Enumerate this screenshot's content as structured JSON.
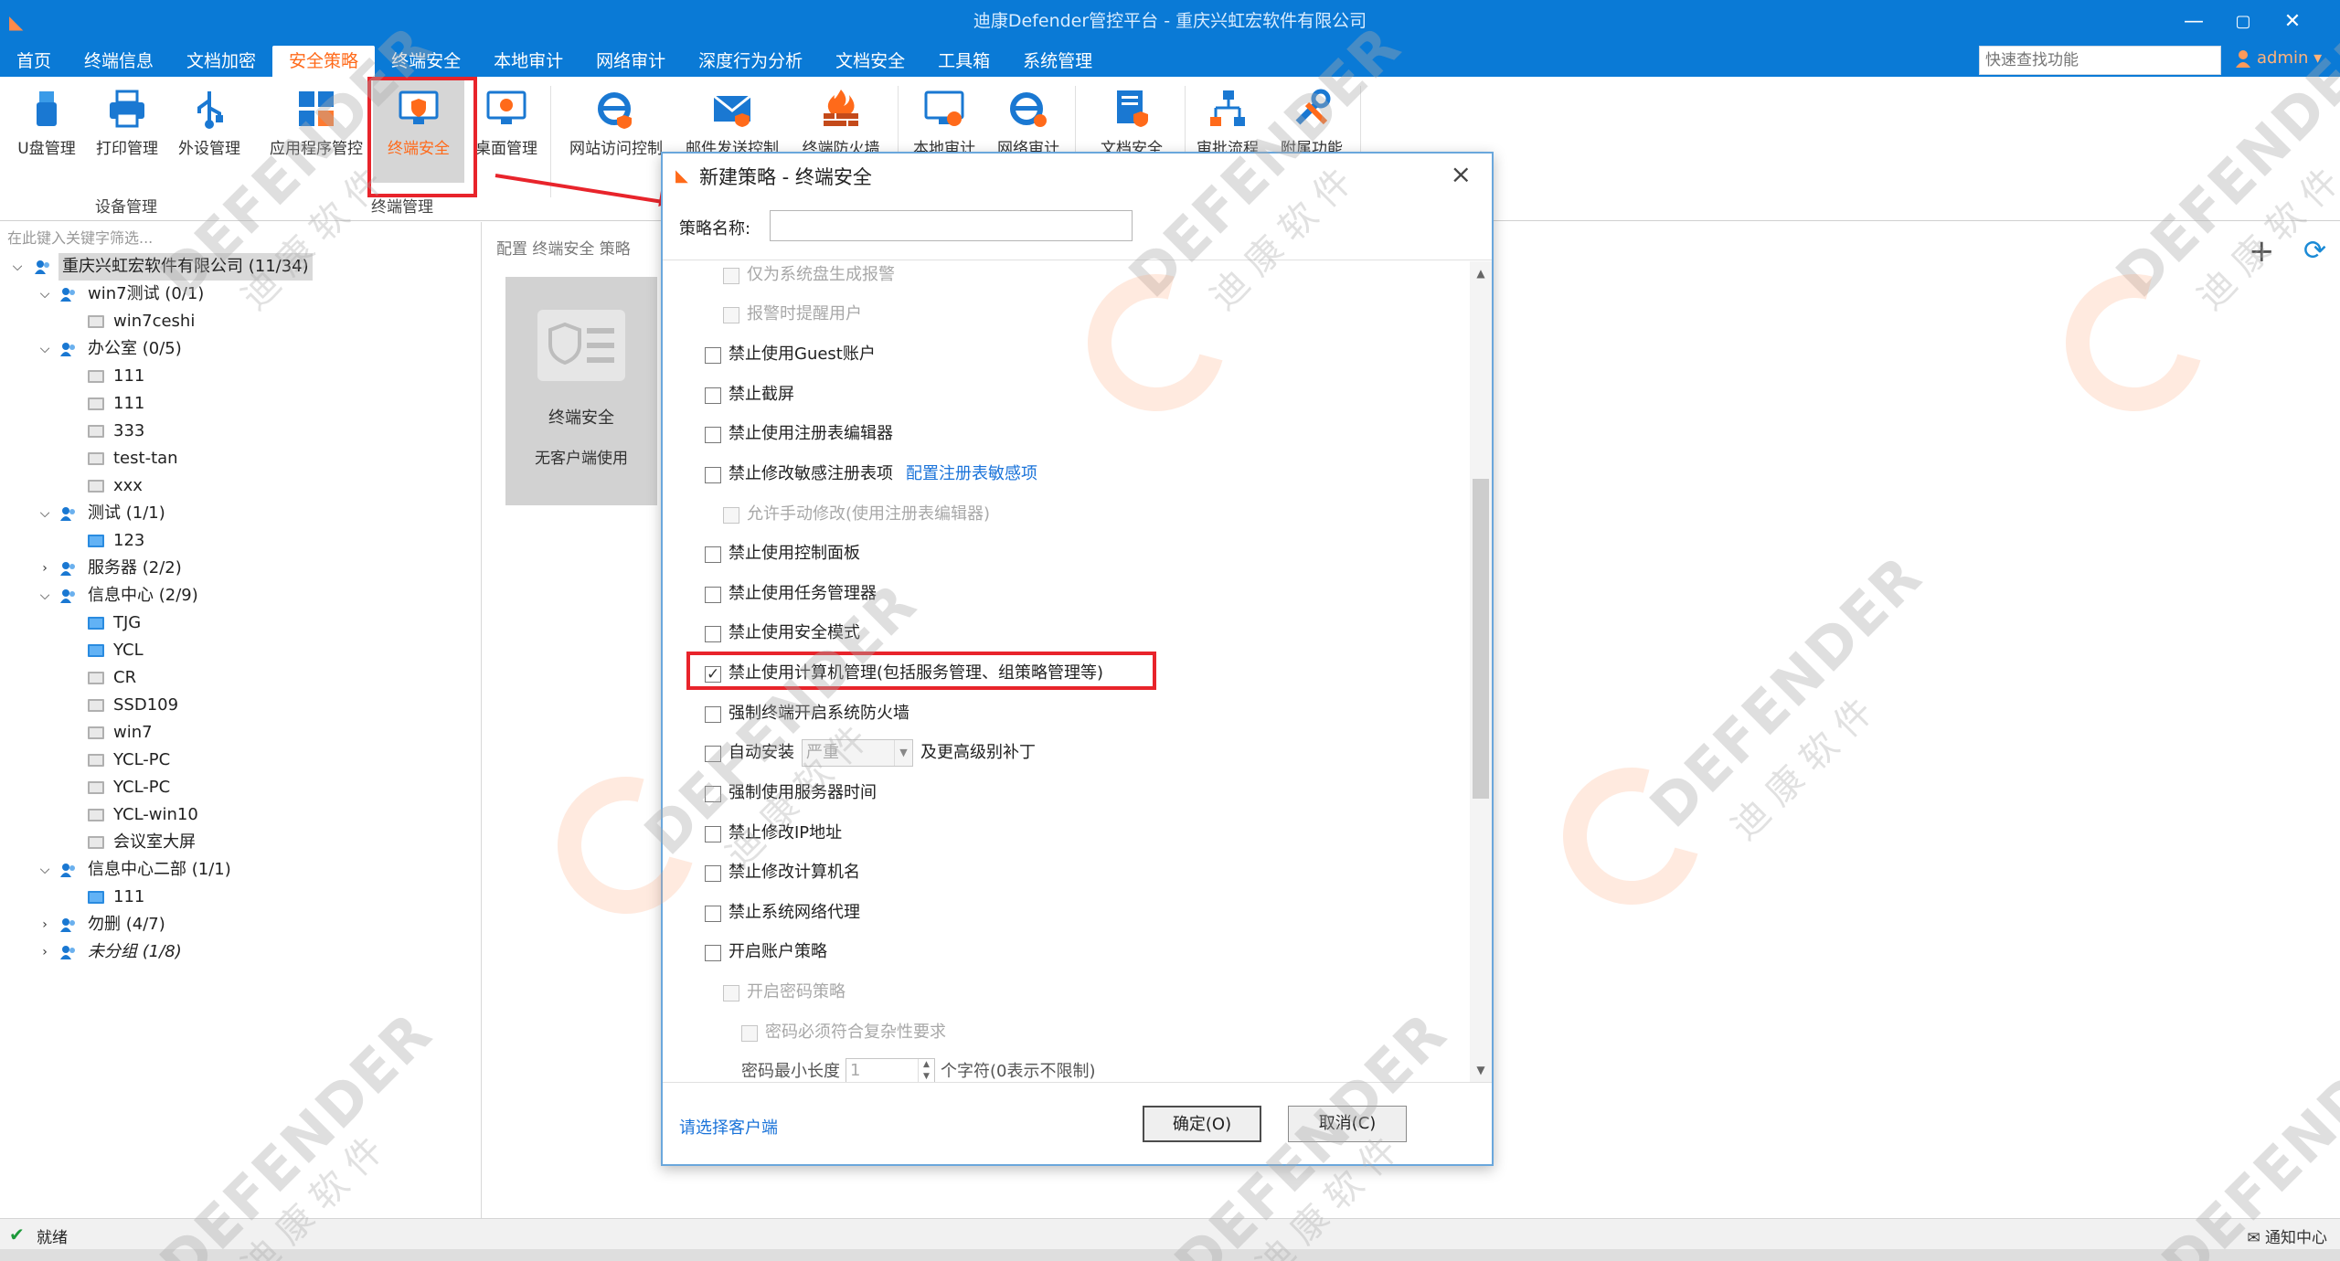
{
  "window": {
    "title": "迪康Defender管控平台 - 重庆兴虹宏软件有限公司",
    "controls": [
      "—",
      "▢",
      "✕"
    ]
  },
  "menu": [
    "首页",
    "终端信息",
    "文档加密",
    "安全策略",
    "终端安全",
    "本地审计",
    "网络审计",
    "深度行为分析",
    "文档安全",
    "工具箱",
    "系统管理"
  ],
  "quick_search_placeholder": "快速查找功能",
  "user": "admin ▾",
  "ribbon": {
    "buttons": [
      "U盘管理",
      "打印管理",
      "外设管理",
      "应用程序管控",
      "终端安全",
      "桌面管理",
      "网站访问控制",
      "邮件发送控制",
      "终端防火墙",
      "本地审计",
      "网络审计",
      "文档安全",
      "审批流程",
      "附属功能"
    ],
    "groups": [
      "设备管理",
      "终端管理"
    ]
  },
  "left_panel": {
    "filter_placeholder": "在此键入关键字筛选...",
    "tree": [
      {
        "label": "重庆兴虹宏软件有限公司 (11/34)"
      },
      {
        "label": "win7测试 (0/1)"
      },
      {
        "label": "win7ceshi"
      },
      {
        "label": "办公室 (0/5)"
      },
      {
        "label": "111"
      },
      {
        "label": "111"
      },
      {
        "label": "333"
      },
      {
        "label": "test-tan"
      },
      {
        "label": "xxx"
      },
      {
        "label": "测试 (1/1)"
      },
      {
        "label": "123"
      },
      {
        "label": "服务器 (2/2)"
      },
      {
        "label": "信息中心 (2/9)"
      },
      {
        "label": "TJG"
      },
      {
        "label": "YCL"
      },
      {
        "label": "CR"
      },
      {
        "label": "SSD109"
      },
      {
        "label": "win7"
      },
      {
        "label": "YCL-PC"
      },
      {
        "label": "YCL-PC"
      },
      {
        "label": "YCL-win10"
      },
      {
        "label": "会议室大屏"
      },
      {
        "label": "信息中心二部 (1/1)"
      },
      {
        "label": "111"
      },
      {
        "label": "勿删 (4/7)"
      },
      {
        "label": "未分组 (1/8)"
      }
    ]
  },
  "mid_panel": {
    "header": "配置 终端安全 策略",
    "tile_title": "终端安全",
    "tile_sub": "无客户端使用"
  },
  "dialog": {
    "title": "新建策略 - 终端安全",
    "policy_name_label": "策略名称:",
    "policy_name_value": "",
    "options": [
      {
        "label": "仅为系统盘生成报警"
      },
      {
        "label": "报警时提醒用户"
      },
      {
        "label": "禁止使用Guest账户"
      },
      {
        "label": "禁止截屏"
      },
      {
        "label": "禁止使用注册表编辑器"
      },
      {
        "label": "禁止修改敏感注册表项",
        "link": "配置注册表敏感项"
      },
      {
        "label": "允许手动修改(使用注册表编辑器)"
      },
      {
        "label": "禁止使用控制面板"
      },
      {
        "label": "禁止使用任务管理器"
      },
      {
        "label": "禁止使用安全模式"
      },
      {
        "label": "禁止使用计算机管理(包括服务管理、组策略管理等)"
      },
      {
        "label": "强制终端开启系统防火墙"
      },
      {
        "label": "自动安装",
        "combo": "严重",
        "suffix": "及更高级别补丁"
      },
      {
        "label": "强制使用服务器时间"
      },
      {
        "label": "禁止修改IP地址"
      },
      {
        "label": "禁止修改计算机名"
      },
      {
        "label": "禁止系统网络代理"
      },
      {
        "label": "开启账户策略"
      },
      {
        "label": "开启密码策略"
      },
      {
        "label": "密码必须符合复杂性要求"
      },
      {
        "label": "密码最小长度",
        "spin": "1",
        "suffix": "个字符(0表示不限制)"
      }
    ],
    "select_client": "请选择客户端",
    "ok": "确定(O)",
    "cancel": "取消(C)"
  },
  "status": {
    "text": "就绪",
    "notify": "通知中心"
  },
  "watermark": {
    "brand": "DEFENDER",
    "cn": "迪 康 软 件"
  },
  "colors": {
    "title_bar": "#0a7ad6",
    "accent": "#ff6a1a",
    "highlight_box": "#e8242b",
    "link": "#1a73d9"
  }
}
